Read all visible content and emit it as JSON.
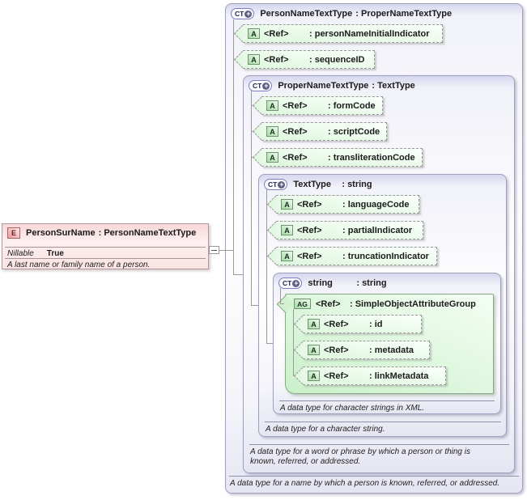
{
  "element": {
    "icon": "E",
    "name": "PersonSurName",
    "type": ": PersonNameTextType",
    "nillable_label": "Nillable",
    "nillable_value": "True",
    "description": "A last name or family name of a person."
  },
  "boxes": {
    "box1": {
      "icon": "CT",
      "plus": "+",
      "name": "PersonNameTextType",
      "type": ": ProperNameTextType",
      "annotation": "A data type for a name by which a person is known, referred, or addressed."
    },
    "box2": {
      "icon": "CT",
      "plus": "+",
      "name": "ProperNameTextType",
      "type": ": TextType",
      "annotation": "A data type for a word or phrase by which a person or thing is known, referred, or addressed."
    },
    "box3": {
      "icon": "CT",
      "plus": "+",
      "name": "TextType",
      "type": ": string",
      "annotation": "A data type for a character string."
    },
    "box4": {
      "icon": "CT",
      "plus": "+",
      "name": "string",
      "type": ": string",
      "annotation": "A data type for character strings in XML."
    }
  },
  "group": {
    "icon": "AG",
    "ref": "<Ref>",
    "name": ": SimpleObjectAttributeGroup"
  },
  "attrs": [
    {
      "icon": "A",
      "ref": "<Ref>",
      "name": ": personNameInitialIndicator"
    },
    {
      "icon": "A",
      "ref": "<Ref>",
      "name": ": sequenceID"
    },
    {
      "icon": "A",
      "ref": "<Ref>",
      "name": ": formCode"
    },
    {
      "icon": "A",
      "ref": "<Ref>",
      "name": ": scriptCode"
    },
    {
      "icon": "A",
      "ref": "<Ref>",
      "name": ": transliterationCode"
    },
    {
      "icon": "A",
      "ref": "<Ref>",
      "name": ": languageCode"
    },
    {
      "icon": "A",
      "ref": "<Ref>",
      "name": ": partialIndicator"
    },
    {
      "icon": "A",
      "ref": "<Ref>",
      "name": ": truncationIndicator"
    },
    {
      "icon": "A",
      "ref": "<Ref>",
      "name": ": id"
    },
    {
      "icon": "A",
      "ref": "<Ref>",
      "name": ": metadata"
    },
    {
      "icon": "A",
      "ref": "<Ref>",
      "name": ": linkMetadata"
    }
  ],
  "toggle": {
    "state": "collapse"
  },
  "colors": {
    "type_header_lavender": "#d6d6ef",
    "element_pink": "#f7d7d7",
    "attribute_green": "#ddf7dd",
    "group_green": "#c9f0c9",
    "line_gray": "#9a9a9a"
  }
}
